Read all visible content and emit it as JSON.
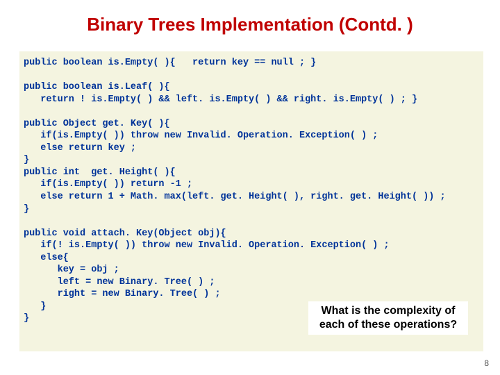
{
  "title": "Binary Trees Implementation (Contd. )",
  "code": "public boolean is.Empty( ){   return key == null ; }\n\npublic boolean is.Leaf( ){\n   return ! is.Empty( ) && left. is.Empty( ) && right. is.Empty( ) ; }\n\npublic Object get. Key( ){\n   if(is.Empty( )) throw new Invalid. Operation. Exception( ) ;\n   else return key ;\n}\npublic int  get. Height( ){\n   if(is.Empty( )) return -1 ;\n   else return 1 + Math. max(left. get. Height( ), right. get. Height( )) ;\n}\n\npublic void attach. Key(Object obj){\n   if(! is.Empty( )) throw new Invalid. Operation. Exception( ) ;\n   else{\n      key = obj ;\n      left = new Binary. Tree( ) ;\n      right = new Binary. Tree( ) ;\n   }\n}",
  "comment": "What is the complexity of each of these operations?",
  "slide_number": "8"
}
